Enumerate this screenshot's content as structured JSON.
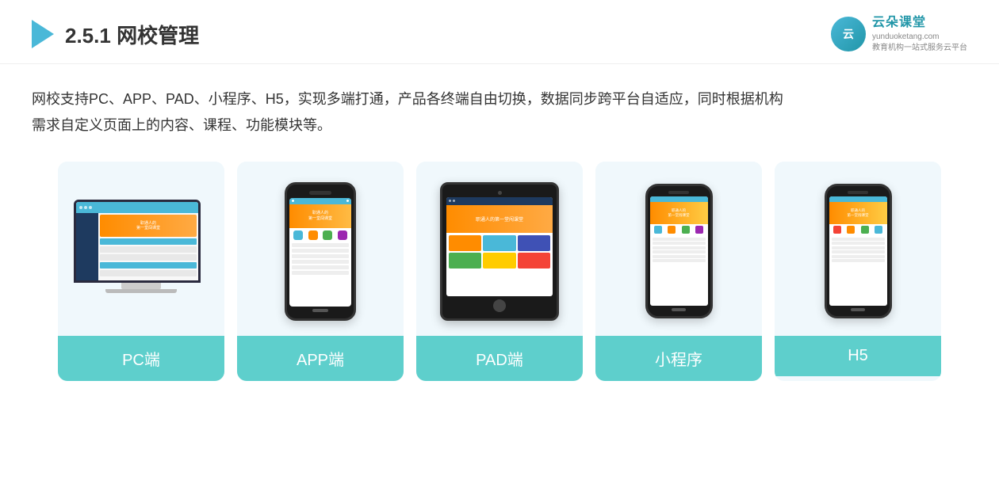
{
  "header": {
    "section_number": "2.5.1",
    "title_bold": "网校管理",
    "brand_name": "云朵课堂",
    "brand_url": "yunduoketang.com",
    "brand_slogan": "教育机构一站式服务云平台"
  },
  "description": {
    "line1": "网校支持PC、APP、PAD、小程序、H5，实现多端打通，产品各终端自由切换，数据同步跨平台自适应，同时根据机构",
    "line2": "需求自定义页面上的内容、课程、功能模块等。"
  },
  "cards": [
    {
      "id": "pc",
      "label": "PC端"
    },
    {
      "id": "app",
      "label": "APP端"
    },
    {
      "id": "pad",
      "label": "PAD端"
    },
    {
      "id": "miniprogram",
      "label": "小程序"
    },
    {
      "id": "h5",
      "label": "H5"
    }
  ]
}
